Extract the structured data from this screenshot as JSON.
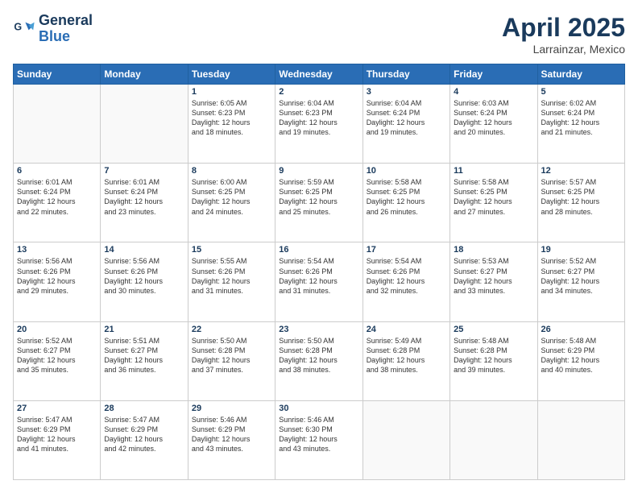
{
  "header": {
    "logo_line1": "General",
    "logo_line2": "Blue",
    "month": "April 2025",
    "location": "Larrainzar, Mexico"
  },
  "weekdays": [
    "Sunday",
    "Monday",
    "Tuesday",
    "Wednesday",
    "Thursday",
    "Friday",
    "Saturday"
  ],
  "weeks": [
    [
      {
        "day": "",
        "info": ""
      },
      {
        "day": "",
        "info": ""
      },
      {
        "day": "1",
        "info": "Sunrise: 6:05 AM\nSunset: 6:23 PM\nDaylight: 12 hours\nand 18 minutes."
      },
      {
        "day": "2",
        "info": "Sunrise: 6:04 AM\nSunset: 6:23 PM\nDaylight: 12 hours\nand 19 minutes."
      },
      {
        "day": "3",
        "info": "Sunrise: 6:04 AM\nSunset: 6:24 PM\nDaylight: 12 hours\nand 19 minutes."
      },
      {
        "day": "4",
        "info": "Sunrise: 6:03 AM\nSunset: 6:24 PM\nDaylight: 12 hours\nand 20 minutes."
      },
      {
        "day": "5",
        "info": "Sunrise: 6:02 AM\nSunset: 6:24 PM\nDaylight: 12 hours\nand 21 minutes."
      }
    ],
    [
      {
        "day": "6",
        "info": "Sunrise: 6:01 AM\nSunset: 6:24 PM\nDaylight: 12 hours\nand 22 minutes."
      },
      {
        "day": "7",
        "info": "Sunrise: 6:01 AM\nSunset: 6:24 PM\nDaylight: 12 hours\nand 23 minutes."
      },
      {
        "day": "8",
        "info": "Sunrise: 6:00 AM\nSunset: 6:25 PM\nDaylight: 12 hours\nand 24 minutes."
      },
      {
        "day": "9",
        "info": "Sunrise: 5:59 AM\nSunset: 6:25 PM\nDaylight: 12 hours\nand 25 minutes."
      },
      {
        "day": "10",
        "info": "Sunrise: 5:58 AM\nSunset: 6:25 PM\nDaylight: 12 hours\nand 26 minutes."
      },
      {
        "day": "11",
        "info": "Sunrise: 5:58 AM\nSunset: 6:25 PM\nDaylight: 12 hours\nand 27 minutes."
      },
      {
        "day": "12",
        "info": "Sunrise: 5:57 AM\nSunset: 6:25 PM\nDaylight: 12 hours\nand 28 minutes."
      }
    ],
    [
      {
        "day": "13",
        "info": "Sunrise: 5:56 AM\nSunset: 6:26 PM\nDaylight: 12 hours\nand 29 minutes."
      },
      {
        "day": "14",
        "info": "Sunrise: 5:56 AM\nSunset: 6:26 PM\nDaylight: 12 hours\nand 30 minutes."
      },
      {
        "day": "15",
        "info": "Sunrise: 5:55 AM\nSunset: 6:26 PM\nDaylight: 12 hours\nand 31 minutes."
      },
      {
        "day": "16",
        "info": "Sunrise: 5:54 AM\nSunset: 6:26 PM\nDaylight: 12 hours\nand 31 minutes."
      },
      {
        "day": "17",
        "info": "Sunrise: 5:54 AM\nSunset: 6:26 PM\nDaylight: 12 hours\nand 32 minutes."
      },
      {
        "day": "18",
        "info": "Sunrise: 5:53 AM\nSunset: 6:27 PM\nDaylight: 12 hours\nand 33 minutes."
      },
      {
        "day": "19",
        "info": "Sunrise: 5:52 AM\nSunset: 6:27 PM\nDaylight: 12 hours\nand 34 minutes."
      }
    ],
    [
      {
        "day": "20",
        "info": "Sunrise: 5:52 AM\nSunset: 6:27 PM\nDaylight: 12 hours\nand 35 minutes."
      },
      {
        "day": "21",
        "info": "Sunrise: 5:51 AM\nSunset: 6:27 PM\nDaylight: 12 hours\nand 36 minutes."
      },
      {
        "day": "22",
        "info": "Sunrise: 5:50 AM\nSunset: 6:28 PM\nDaylight: 12 hours\nand 37 minutes."
      },
      {
        "day": "23",
        "info": "Sunrise: 5:50 AM\nSunset: 6:28 PM\nDaylight: 12 hours\nand 38 minutes."
      },
      {
        "day": "24",
        "info": "Sunrise: 5:49 AM\nSunset: 6:28 PM\nDaylight: 12 hours\nand 38 minutes."
      },
      {
        "day": "25",
        "info": "Sunrise: 5:48 AM\nSunset: 6:28 PM\nDaylight: 12 hours\nand 39 minutes."
      },
      {
        "day": "26",
        "info": "Sunrise: 5:48 AM\nSunset: 6:29 PM\nDaylight: 12 hours\nand 40 minutes."
      }
    ],
    [
      {
        "day": "27",
        "info": "Sunrise: 5:47 AM\nSunset: 6:29 PM\nDaylight: 12 hours\nand 41 minutes."
      },
      {
        "day": "28",
        "info": "Sunrise: 5:47 AM\nSunset: 6:29 PM\nDaylight: 12 hours\nand 42 minutes."
      },
      {
        "day": "29",
        "info": "Sunrise: 5:46 AM\nSunset: 6:29 PM\nDaylight: 12 hours\nand 43 minutes."
      },
      {
        "day": "30",
        "info": "Sunrise: 5:46 AM\nSunset: 6:30 PM\nDaylight: 12 hours\nand 43 minutes."
      },
      {
        "day": "",
        "info": ""
      },
      {
        "day": "",
        "info": ""
      },
      {
        "day": "",
        "info": ""
      }
    ]
  ]
}
